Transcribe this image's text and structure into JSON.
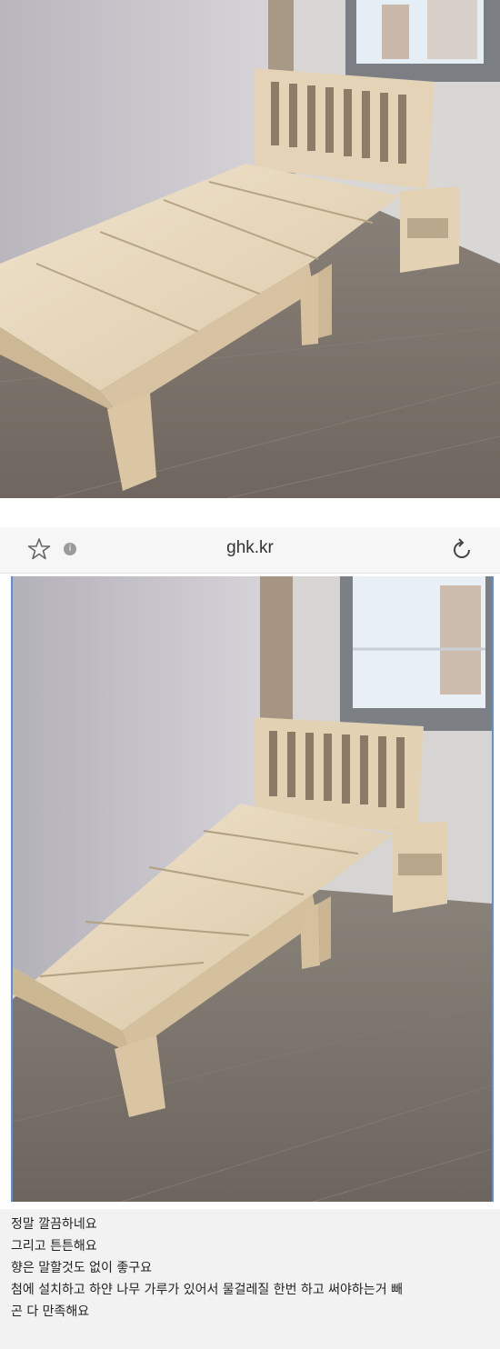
{
  "browser": {
    "domain": "ghk.kr",
    "icons": [
      "star-icon",
      "info-icon",
      "reload-icon"
    ]
  },
  "caption": {
    "lines": [
      "정말 깔끔하네요",
      "그리고 튼튼해요",
      "향은 말할것도 없이 좋구요",
      "첨에 설치하고 하얀 나무 가루가 있어서 물걸레질 한번 하고 써야하는거 빼",
      "곤 다 만족해요"
    ]
  },
  "colors": {
    "wall": "#c9c7cc",
    "floor": "#7f776f",
    "wood": "#e7d8bf",
    "frame_border": "#5b8fd8",
    "caption_bg": "#f2f2f2"
  }
}
